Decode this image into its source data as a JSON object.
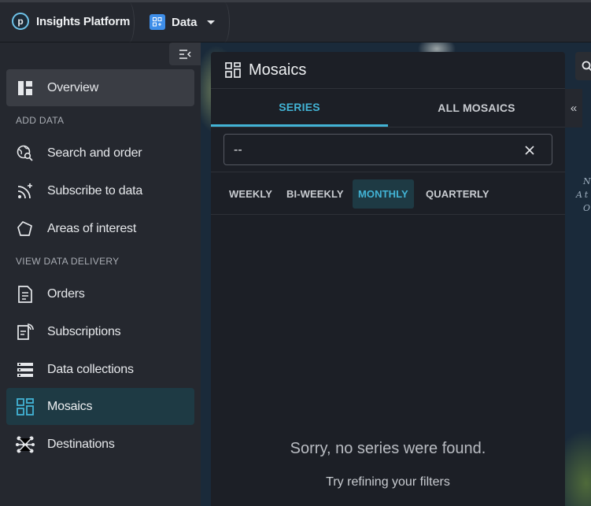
{
  "topbar": {
    "app_name": "Insights Platform",
    "logo_letter": "p",
    "data_menu_label": "Data"
  },
  "sidebar": {
    "overview_label": "Overview",
    "section_add_data": "ADD DATA",
    "search_order_label": "Search and order",
    "subscribe_label": "Subscribe to data",
    "areas_label": "Areas of interest",
    "section_view_delivery": "VIEW DATA DELIVERY",
    "orders_label": "Orders",
    "subscriptions_label": "Subscriptions",
    "collections_label": "Data collections",
    "mosaics_label": "Mosaics",
    "destinations_label": "Destinations"
  },
  "panel": {
    "title": "Mosaics",
    "tabs": [
      {
        "label": "SERIES"
      },
      {
        "label": "ALL MOSAICS"
      }
    ],
    "search_value": "--",
    "chips": [
      {
        "label": "WEEKLY"
      },
      {
        "label": "BI-WEEKLY"
      },
      {
        "label": "MONTHLY"
      },
      {
        "label": "QUARTERLY"
      }
    ],
    "empty_title": "Sorry, no series were found.",
    "empty_subtitle": "Try refining your filters"
  },
  "map_labels": {
    "line1": "N",
    "line2": "At",
    "line3": "O"
  },
  "colors": {
    "accent": "#42b3d5",
    "active_bg": "#1e3a44",
    "sidebar_bg": "#25282f",
    "panel_bg": "#1c1f26"
  }
}
